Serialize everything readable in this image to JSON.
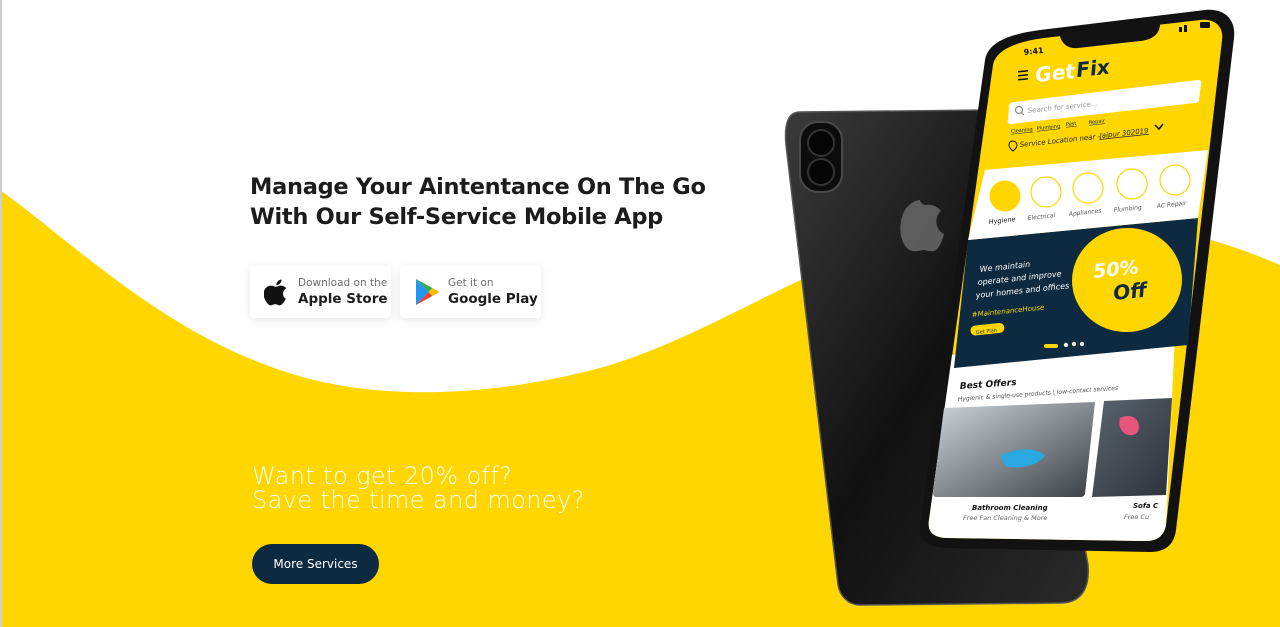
{
  "hero": {
    "headline_line1": "Manage Your Aintentance On The Go",
    "headline_line2": "With Our Self-Service Mobile App"
  },
  "store_buttons": {
    "apple": {
      "small": "Download on the",
      "big": "Apple Store"
    },
    "google": {
      "small": "Get it on",
      "big": "Google Play"
    }
  },
  "offer": {
    "line1": "Want to get 20% off?",
    "line2": "Save the time and money?"
  },
  "cta": {
    "label": "More Services"
  },
  "phone": {
    "time": "9:41",
    "brand_part1": "Get",
    "brand_part2": "Fix",
    "search_placeholder": "Search for service...",
    "quick_links": [
      "Cleaning",
      "Plumbing",
      "Pest",
      "Repair"
    ],
    "location_prefix": "Service Location near -",
    "location_value": "Jaipur 302019",
    "categories": [
      "Hygiene",
      "Electrical",
      "Appliances",
      "Plumbing",
      "AC Repair"
    ],
    "banner_line1": "We maintain",
    "banner_line2": "operate and improve",
    "banner_line3": "your homes and offices",
    "banner_hashtag": "#MaintenanceHouse",
    "banner_button": "Get Plan",
    "banner_percent": "50%",
    "banner_off": "Off",
    "best_offers_title": "Best Offers",
    "best_offers_subtitle": "Hygienic & single-use products | low-contact services",
    "offer1_title": "Bathroom Cleaning",
    "offer1_sub": "Free Fan Cleaning & More",
    "offer2_title": "Sofa C",
    "offer2_sub": "Free Cu"
  },
  "colors": {
    "brand_yellow": "#FFD600",
    "navy": "#0d2a40",
    "text_dark": "#1c1c1c"
  },
  "icons": [
    "apple-icon",
    "google-play-icon",
    "menu-icon",
    "search-icon",
    "location-pin-icon",
    "chevron-down-icon"
  ]
}
